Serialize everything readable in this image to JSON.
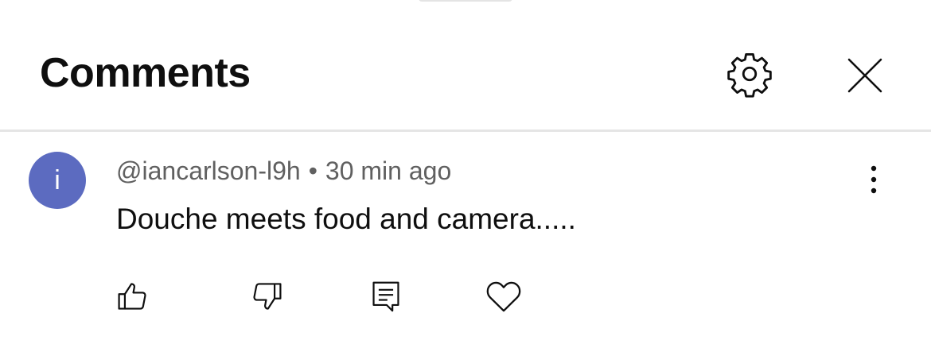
{
  "header": {
    "title": "Comments",
    "settings_icon": "gear-icon",
    "close_icon": "close-icon"
  },
  "comment": {
    "avatar_letter": "i",
    "avatar_color": "#5c6bc0",
    "author": "@iancarlson-l9h",
    "separator": "•",
    "time": "30 min ago",
    "text": "Douche meets food and camera.....",
    "more_icon": "more-vert-icon",
    "actions": [
      {
        "name": "like",
        "icon": "thumbs-up-icon"
      },
      {
        "name": "dislike",
        "icon": "thumbs-down-icon"
      },
      {
        "name": "reply",
        "icon": "comment-reply-icon"
      },
      {
        "name": "heart",
        "icon": "heart-icon"
      }
    ]
  },
  "colors": {
    "text_primary": "#0f0f0f",
    "text_secondary": "#606060",
    "divider": "#e5e5e5"
  }
}
